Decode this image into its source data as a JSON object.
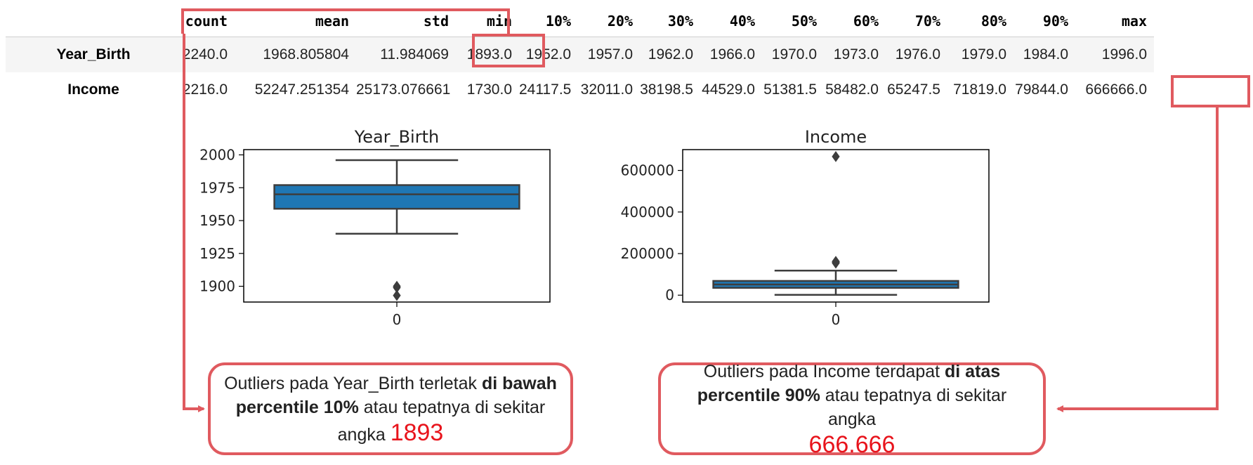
{
  "table": {
    "columns": [
      "count",
      "mean",
      "std",
      "min",
      "10%",
      "20%",
      "30%",
      "40%",
      "50%",
      "60%",
      "70%",
      "80%",
      "90%",
      "max"
    ],
    "rows": [
      {
        "label": "Year_Birth",
        "cells": [
          "2240.0",
          "1968.805804",
          "11.984069",
          "1893.0",
          "1952.0",
          "1957.0",
          "1962.0",
          "1966.0",
          "1970.0",
          "1973.0",
          "1976.0",
          "1979.0",
          "1984.0",
          "1996.0"
        ]
      },
      {
        "label": "Income",
        "cells": [
          "2216.0",
          "52247.251354",
          "25173.076661",
          "1730.0",
          "24117.5",
          "32011.0",
          "38198.5",
          "44529.0",
          "51381.5",
          "58482.0",
          "65247.5",
          "71819.0",
          "79844.0",
          "666666.0"
        ]
      }
    ]
  },
  "chart_data": [
    {
      "type": "box",
      "title": "Year_Birth",
      "categories": [
        "0"
      ],
      "ylim": [
        1888,
        2004
      ],
      "yticks": [
        1900,
        1925,
        1950,
        1975,
        2000
      ],
      "box": {
        "whisker_low": 1940,
        "q1": 1959,
        "median": 1970,
        "q3": 1977,
        "whisker_high": 1996
      },
      "outliers": [
        1893,
        1899,
        1900
      ],
      "color": "#1f77b4"
    },
    {
      "type": "box",
      "title": "Income",
      "categories": [
        "0"
      ],
      "ylim": [
        -33000,
        700000
      ],
      "yticks": [
        0,
        200000,
        400000,
        600000
      ],
      "box": {
        "whisker_low": 1730,
        "q1": 35303,
        "median": 51381.5,
        "q3": 68522,
        "whisker_high": 118000
      },
      "outliers": [
        153924,
        157146,
        160803,
        162397,
        666666
      ],
      "color": "#1f77b4"
    }
  ],
  "notes": {
    "left": {
      "line1_pre": "Outliers pada Year_Birth terletak ",
      "line1_bold": "di bawah",
      "line2_bold": "percentile 10%",
      "line2_post": " atau tepatnya di sekitar",
      "line3_pre": "angka ",
      "line3_value": "1893"
    },
    "right": {
      "line1_pre": "Outliers pada Income terdapat ",
      "line1_bold": "di atas",
      "line2_bold": "percentile 90%",
      "line2_post": " atau tepatnya di sekitar angka",
      "line3_value": "666.666"
    }
  },
  "colors": {
    "accent": "#e05a5f",
    "highlight": "#e8141c",
    "box": "#1f77b4"
  }
}
